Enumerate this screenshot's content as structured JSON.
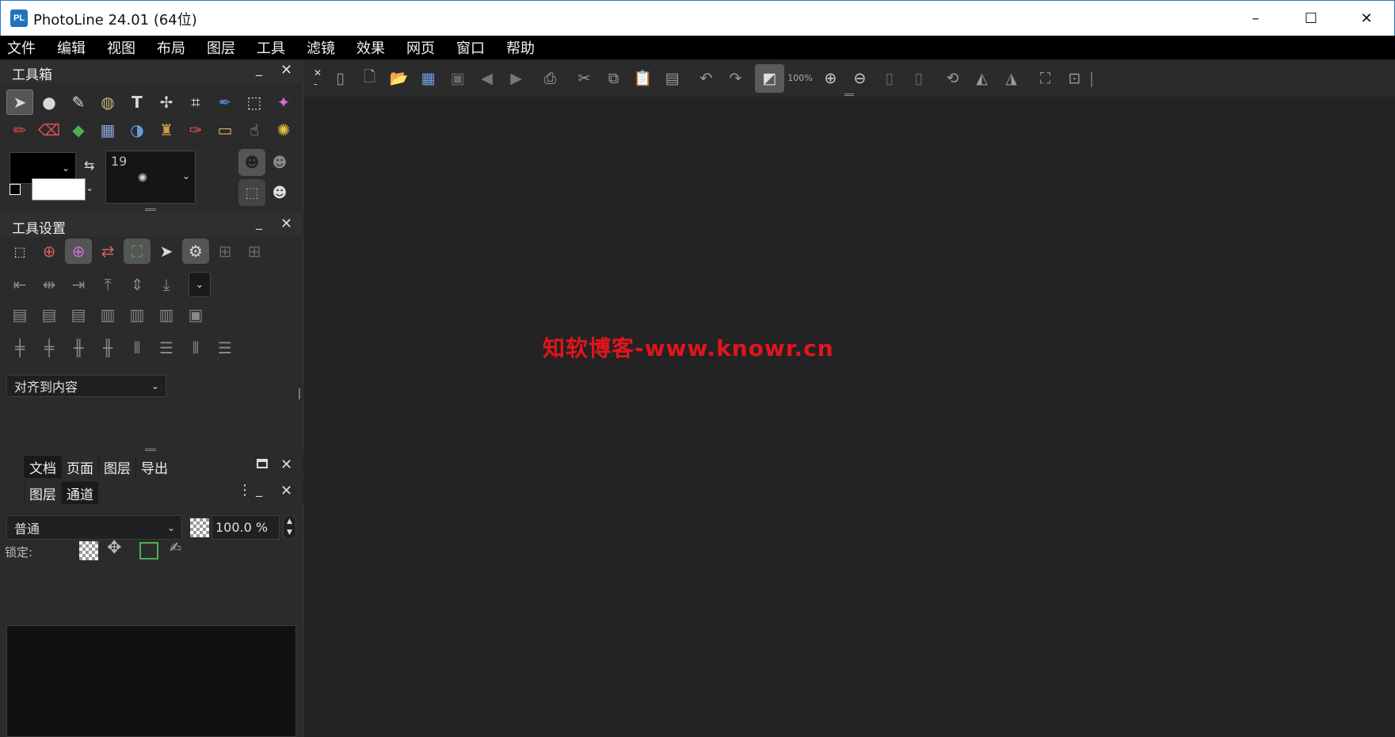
{
  "window": {
    "title": "PhotoLine 24.01 (64位)",
    "logo": "PL",
    "minimize": "–",
    "maximize": "☐",
    "close": "✕"
  },
  "menu": [
    "文件",
    "编辑",
    "视图",
    "布局",
    "图层",
    "工具",
    "滤镜",
    "效果",
    "网页",
    "窗口",
    "帮助"
  ],
  "toolbox": {
    "title": "工具箱",
    "brush_size": "19",
    "row1": [
      "arrow-pointer-icon",
      "circle-tool-icon",
      "brush-preset-icon",
      "sphere-icon",
      "text-tool-icon",
      "vector-path-icon",
      "crop-icon",
      "pen-icon",
      "rect-select-icon",
      "magic-wand-icon"
    ],
    "row1_glyphs": [
      "➤",
      "●",
      "✎",
      "◍",
      "T",
      "✢",
      "⌗",
      "✒",
      "⬚",
      "✦"
    ],
    "row2": [
      "paintbrush-icon",
      "eraser-icon",
      "fill-bucket-icon",
      "gradient-icon",
      "smudge-icon",
      "stamp-icon",
      "clone-brush-icon",
      "bandage-icon",
      "finger-icon",
      "dodge-icon"
    ],
    "row2_glyphs": [
      "✏",
      "⌫",
      "◆",
      "▦",
      "◑",
      "♜",
      "✑",
      "▭",
      "☝",
      "✺"
    ]
  },
  "tool_settings": {
    "title": "工具设置",
    "align_option": "对齐到内容"
  },
  "doc_tabs": [
    "文档",
    "页面",
    "图层",
    "导出"
  ],
  "layer_tabs": [
    "图层",
    "通道"
  ],
  "layers": {
    "blend_mode": "普通",
    "opacity": "100.0 %",
    "lock_label": "锁定:"
  },
  "toolbar": {
    "zoom": "100%"
  },
  "watermark": "知软博客-www.knowr.cn"
}
